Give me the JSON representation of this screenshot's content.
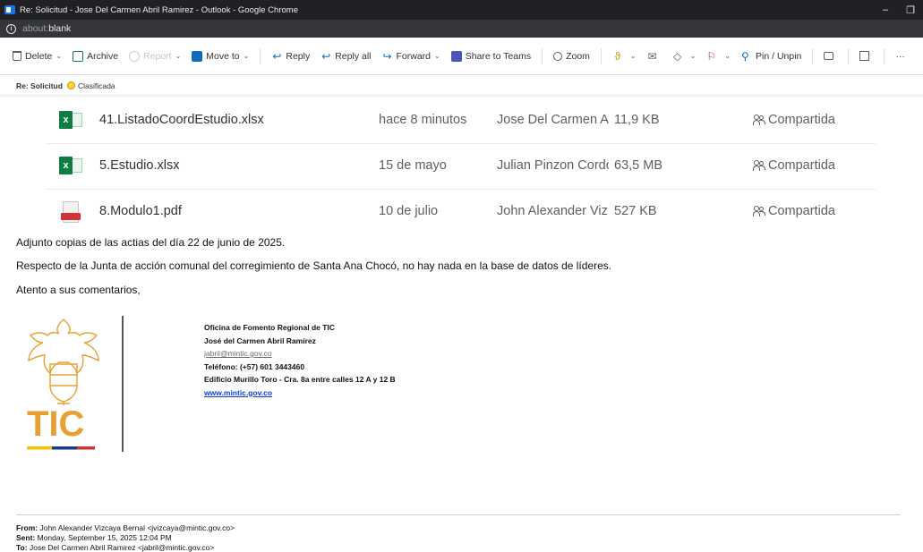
{
  "window": {
    "title": "Re: Solicitud - Jose Del Carmen Abril Ramirez - Outlook - Google Chrome",
    "minimize_glyph": "–",
    "restore_glyph": "❐"
  },
  "address_bar": {
    "url_prefix": "about:",
    "url_host": "blank"
  },
  "toolbar": {
    "delete": "Delete",
    "archive": "Archive",
    "report": "Report",
    "move_to": "Move to",
    "reply": "Reply",
    "reply_all": "Reply all",
    "forward": "Forward",
    "share_to_teams": "Share to Teams",
    "zoom": "Zoom",
    "pin_unpin": "Pin / Unpin",
    "more": "···"
  },
  "subject_bar": {
    "subject": "Re: Solicitud",
    "label": "Clasificada"
  },
  "attachments": [
    {
      "icon": "excel-icon",
      "name": "41.ListadoCoordEstudio.xlsx",
      "modified": "hace 8 minutos",
      "owner": "Jose Del Carmen Al",
      "size": "11,9 KB",
      "sharing": "Compartida"
    },
    {
      "icon": "excel-icon",
      "name": "5.Estudio.xlsx",
      "modified": "15 de mayo",
      "owner": "Julian Pinzon Cordc",
      "size": "63,5 MB",
      "sharing": "Compartida"
    },
    {
      "icon": "pdf-icon",
      "name": "8.Modulo1.pdf",
      "modified": "10 de julio",
      "owner": "John Alexander Viz",
      "size": "527 KB",
      "sharing": "Compartida"
    }
  ],
  "message": {
    "line1": "Adjunto copias de las actias del día 22 de junio de 2025.",
    "line2": "Respecto de la Junta de acción comunal del corregimiento de Santa Ana Chocó, no hay nada en la base de datos de líderes.",
    "line3": "Atento a sus comentarios,"
  },
  "signature": {
    "logo_text": "TIC",
    "office": "Oficina de Fomento Regional de TIC",
    "name": "José del Carmen Abril Ramírez",
    "email": "jabril@mintic.gov.co",
    "phone": "Teléfono: (+57) 601 3443460",
    "address": "Edificio Murillo Toro - Cra. 8a entre calles 12 A y 12 B",
    "website": "www.mintic.gov.co"
  },
  "forwarded_header": {
    "from_label": "From:",
    "from_value": "John Alexander Vizcaya Bernal <jvizcaya@mintic.gov.co>",
    "sent_label": "Sent:",
    "sent_value": "Monday, September 15, 2025 12:04 PM",
    "to_label": "To:",
    "to_value": "Jose Del Carmen Abril Ramirez <jabril@mintic.gov.co>"
  },
  "colors": {
    "excel_green": "#107c41",
    "pdf_red": "#d13438",
    "tic_orange": "#e8a033",
    "link_blue": "#0b3cde",
    "flag_red": "#a4262c",
    "label_yellow": "#ffd335"
  }
}
